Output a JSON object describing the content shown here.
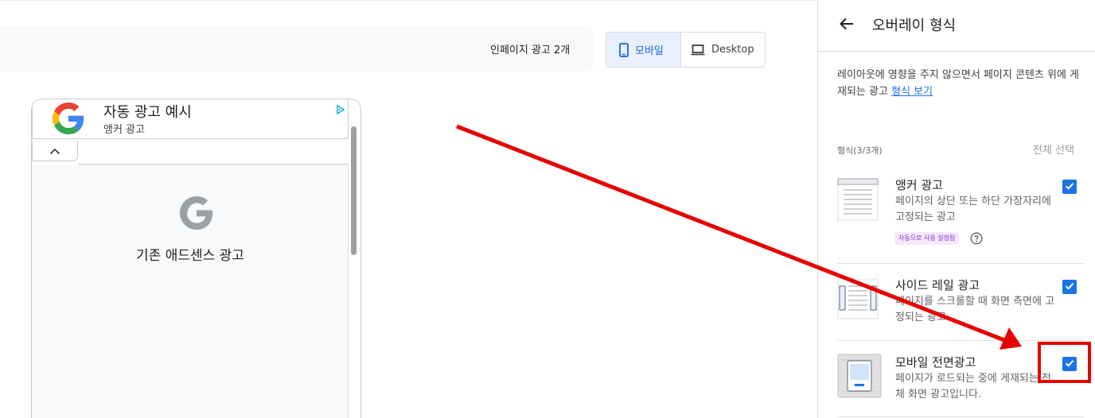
{
  "preview": {
    "ad_count_label": "인페이지 광고 2개",
    "device_toggle": {
      "mobile_label": "모바일",
      "desktop_label": "Desktop",
      "selected": "mobile"
    },
    "phone": {
      "anchor_ad": {
        "title": "자동 광고 예시",
        "subtitle": "앵커 광고"
      },
      "existing_ad_label": "기존 애드센스 광고"
    }
  },
  "panel": {
    "title": "오버레이 형식",
    "description": "레이아웃에 영향을 주지 않으면서 페이지 콘텐츠 위에 게재되는 광고",
    "description_link": "형식 보기",
    "formats_count": "형식(3/3개)",
    "select_all": "전체 선택",
    "formats": [
      {
        "title": "앵커 광고",
        "desc": "페이지의 상단 또는 하단 가장자리에 고정되는 광고",
        "badge": "자동으로 사용 설정됨",
        "checked": true
      },
      {
        "title": "사이드 레일 광고",
        "desc": "페이지를 스크롤할 때 화면 측면에 고정되는 광고",
        "checked": true
      },
      {
        "title": "모바일 전면광고",
        "desc": "페이지가 로드되는 중에 게재되는 전체 화면 광고입니다.",
        "checked": true
      }
    ]
  },
  "colors": {
    "accent": "#1a73e8",
    "selected_toggle_bg": "#e8f0fe",
    "annotation_red": "#e60000",
    "badge_bg": "#f3e8fd",
    "badge_text": "#8430ce"
  },
  "icons": [
    "mobile-phone-icon",
    "laptop-icon",
    "google-g-logo",
    "adchoices-icon",
    "chevron-up-icon",
    "back-arrow-icon",
    "checkmark-icon",
    "help-circle-icon",
    "anchor-ad-illustration",
    "side-rail-illustration",
    "interstitial-illustration"
  ]
}
